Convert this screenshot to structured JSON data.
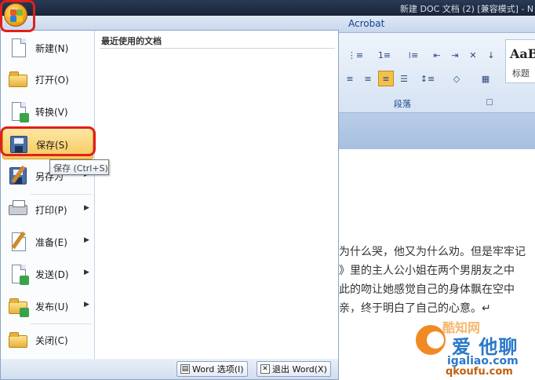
{
  "window": {
    "title": "新建 DOC 文档 (2) [兼容模式] - N",
    "tab": "Acrobat"
  },
  "ribbon": {
    "paragraph_group_label": "段落",
    "style_sample": "AaB",
    "style_name": "标题"
  },
  "document": {
    "lines": [
      "为什么哭，他又为什么劝。但是牢牢记",
      "》里的主人公小姐在两个男朋友之中",
      "此的吻让她感觉自己的身体飘在空中",
      "亲，终于明白了自己的心意。↵"
    ]
  },
  "office_menu": {
    "recent_docs_header": "最近使用的文档",
    "items": [
      {
        "label": "新建(N)",
        "has_submenu": false
      },
      {
        "label": "打开(O)",
        "has_submenu": false
      },
      {
        "label": "转换(V)",
        "has_submenu": false
      },
      {
        "label": "保存(S)",
        "has_submenu": false
      },
      {
        "label": "另存为",
        "has_submenu": true
      },
      {
        "label": "打印(P)",
        "has_submenu": true
      },
      {
        "label": "准备(E)",
        "has_submenu": true
      },
      {
        "label": "发送(D)",
        "has_submenu": true
      },
      {
        "label": "发布(U)",
        "has_submenu": true
      },
      {
        "label": "关闭(C)",
        "has_submenu": false
      }
    ],
    "footer": {
      "word_options": "Word 选项(I)",
      "exit_word": "退出 Word(X)"
    }
  },
  "tooltip": "保存 (Ctrl+S)",
  "watermark": {
    "sub": "酷知网",
    "main": "爱 他聊",
    "domain": "igaliao.com",
    "url": "qkoufu.com"
  },
  "colors": {
    "highlight_red": "#e0201b",
    "selected_item": "#f7c85a",
    "office_orb": "#f0a21a"
  }
}
